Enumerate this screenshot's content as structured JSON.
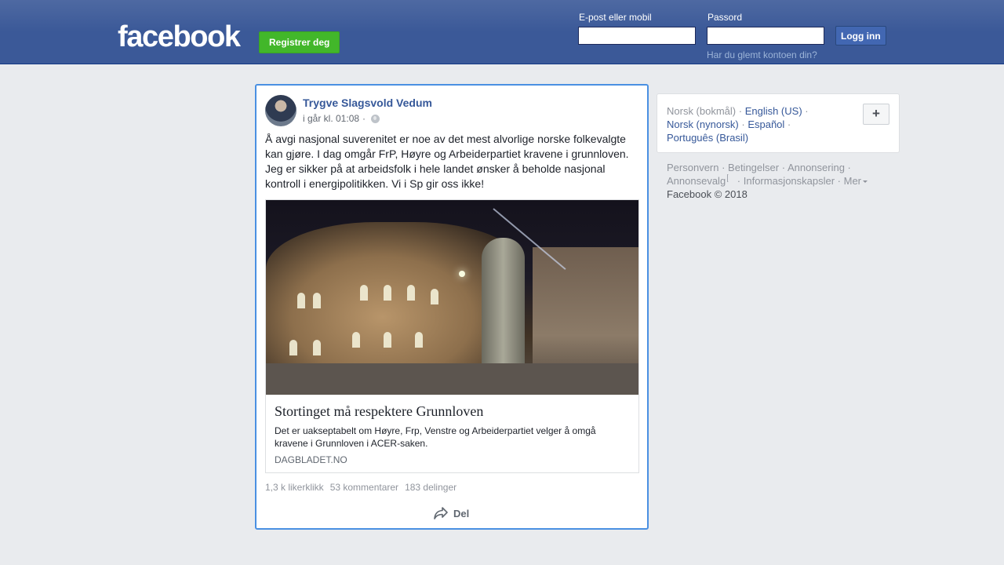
{
  "header": {
    "logo": "facebook",
    "register_label": "Registrer deg",
    "email_label": "E-post eller mobil",
    "password_label": "Passord",
    "login_label": "Logg inn",
    "forgot_label": "Har du glemt kontoen din?"
  },
  "post": {
    "author": "Trygve Slagsvold Vedum",
    "timestamp": "i går kl. 01:08",
    "separator": "·",
    "text": "Å avgi nasjonal suverenitet er noe av det mest alvorlige norske folkevalgte kan gjøre. I dag omgår FrP, Høyre og Arbeiderpartiet kravene i grunnloven. Jeg er sikker på at arbeidsfolk i hele landet ønsker å beholde nasjonal kontroll i energipolitikken. Vi i Sp gir oss ikke!",
    "link": {
      "title": "Stortinget må respektere Grunnloven",
      "description": "Det er uakseptabelt om Høyre, Frp, Venstre og Arbeiderpartiet velger å omgå kravene i Grunnloven i ACER-saken.",
      "domain": "DAGBLADET.NO"
    },
    "likes": "1,3 k likerklikk",
    "comments": "53 kommentarer",
    "shares": "183 delinger",
    "share_label": "Del"
  },
  "languages": {
    "current": "Norsk (bokmål)",
    "items": [
      "English (US)",
      "Norsk (nynorsk)",
      "Español",
      "Português (Brasil)"
    ],
    "add_label": "+"
  },
  "footer": {
    "links": [
      "Personvern",
      "Betingelser",
      "Annonsering",
      "Annonsevalg",
      "Informasjonskapsler",
      "Mer"
    ],
    "copyright": "Facebook © 2018"
  },
  "colors": {
    "header_bg": "#3b5998",
    "register_green": "#42b72a",
    "link_blue": "#365899",
    "focus_border": "#4a90e2"
  }
}
